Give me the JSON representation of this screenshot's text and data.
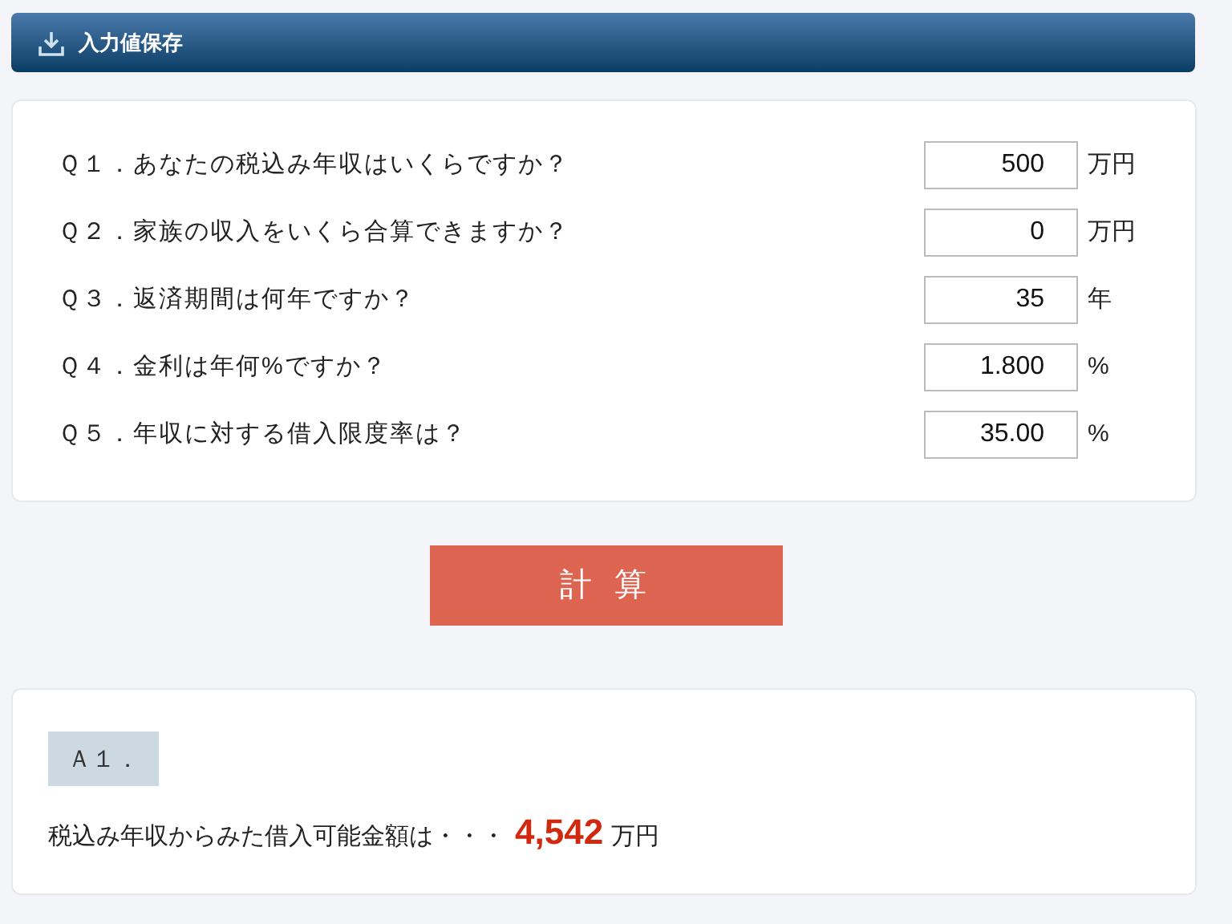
{
  "header": {
    "title": "入力値保存"
  },
  "questions": [
    {
      "label": "Ｑ１．あなたの税込み年収はいくらですか？",
      "value": "500",
      "unit": "万円"
    },
    {
      "label": "Ｑ２．家族の収入をいくら合算できますか？",
      "value": "0",
      "unit": "万円"
    },
    {
      "label": "Ｑ３．返済期間は何年ですか？",
      "value": "35",
      "unit": "年"
    },
    {
      "label": "Ｑ４．金利は年何%ですか？",
      "value": "1.800",
      "unit": "%"
    },
    {
      "label": "Ｑ５．年収に対する借入限度率は？",
      "value": "35.00",
      "unit": "%"
    }
  ],
  "calculate_button": "計 算",
  "answer": {
    "label": "Ａ１．",
    "text": "税込み年収からみた借入可能金額は・・・",
    "amount": "4,542",
    "unit": "万円"
  }
}
